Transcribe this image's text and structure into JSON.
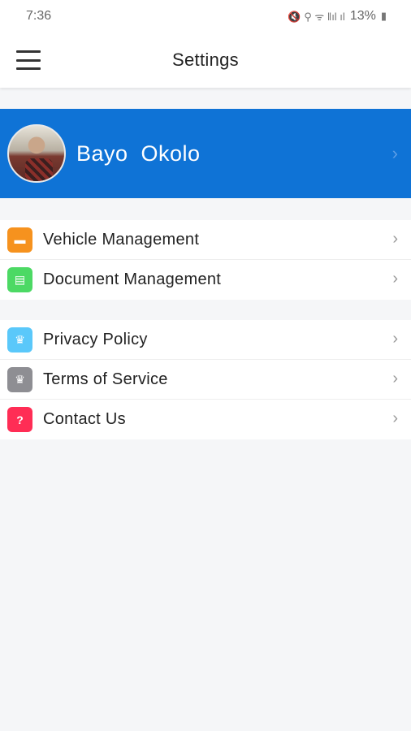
{
  "status": {
    "time": "7:36",
    "indicators": "🔇 ⚲ ᯤ ‖ıl ıl",
    "battery": "13%"
  },
  "appbar": {
    "title": "Settings",
    "menu_icon": "hamburger-menu-icon"
  },
  "profile": {
    "name": "Bayo  Okolo",
    "chevron": "›"
  },
  "groups": {
    "management": [
      {
        "label": "Vehicle Management",
        "icon": "car-icon",
        "glyph": "▬",
        "color": "#f6921e"
      },
      {
        "label": "Document Management",
        "icon": "document-icon",
        "glyph": "▤",
        "color": "#4cd964"
      }
    ],
    "info": [
      {
        "label": "Privacy Policy",
        "icon": "crown-icon",
        "glyph": "♛",
        "color": "#5ac8fa"
      },
      {
        "label": "Terms of Service",
        "icon": "crown-icon",
        "glyph": "♛",
        "color": "#8e8e93"
      },
      {
        "label": "Contact Us",
        "icon": "question-icon",
        "glyph": "?",
        "color": "#ff2d55"
      }
    ]
  },
  "chevron": "›"
}
